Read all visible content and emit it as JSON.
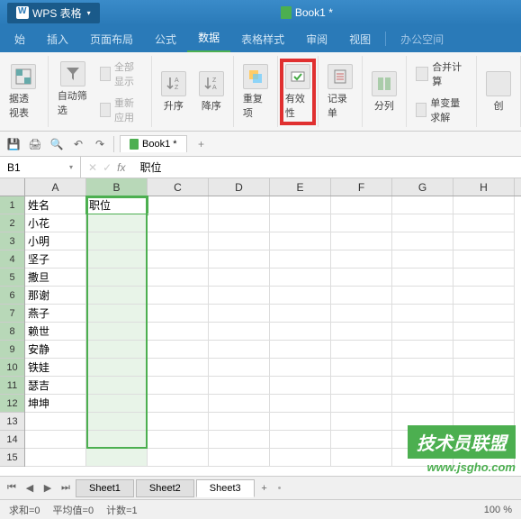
{
  "app": {
    "title": "WPS 表格",
    "doc_title": "Book1 *"
  },
  "tabs": {
    "start": "始",
    "insert": "插入",
    "layout": "页面布局",
    "formula": "公式",
    "data": "数据",
    "style": "表格样式",
    "review": "审阅",
    "view": "视图",
    "office": "办公空间"
  },
  "ribbon": {
    "pivot": "据透视表",
    "auto_filter": "自动筛选",
    "show_all": "全部显示",
    "reapply": "重新应用",
    "sort_asc": "升序",
    "sort_desc": "降序",
    "duplicates": "重复项",
    "validity": "有效性",
    "record": "记录单",
    "columns": "分列",
    "consolidate": "合并计算",
    "solver": "单变量求解",
    "create": "创"
  },
  "qat_doc": "Book1 *",
  "formula_bar": {
    "name_box": "B1",
    "fx": "fx",
    "value": "职位"
  },
  "columns": [
    "A",
    "B",
    "C",
    "D",
    "E",
    "F",
    "G",
    "H"
  ],
  "row_count": 15,
  "data_rows": [
    {
      "a": "姓名",
      "b": "职位"
    },
    {
      "a": "小花",
      "b": ""
    },
    {
      "a": "小明",
      "b": ""
    },
    {
      "a": "坚子",
      "b": ""
    },
    {
      "a": "撒旦",
      "b": ""
    },
    {
      "a": "那谢",
      "b": ""
    },
    {
      "a": "燕子",
      "b": ""
    },
    {
      "a": "赖世",
      "b": ""
    },
    {
      "a": "安静",
      "b": ""
    },
    {
      "a": "铁娃",
      "b": ""
    },
    {
      "a": "瑟吉",
      "b": ""
    },
    {
      "a": "坤坤",
      "b": ""
    },
    {
      "a": "",
      "b": ""
    },
    {
      "a": "",
      "b": ""
    },
    {
      "a": "",
      "b": ""
    }
  ],
  "sheets": {
    "s1": "Sheet1",
    "s2": "Sheet2",
    "s3": "Sheet3"
  },
  "status": {
    "sum": "求和=0",
    "avg": "平均值=0",
    "count": "计数=1",
    "zoom": "100 %"
  },
  "watermark": {
    "line1": "技术员联盟",
    "line2": "www.jsgho.com"
  }
}
